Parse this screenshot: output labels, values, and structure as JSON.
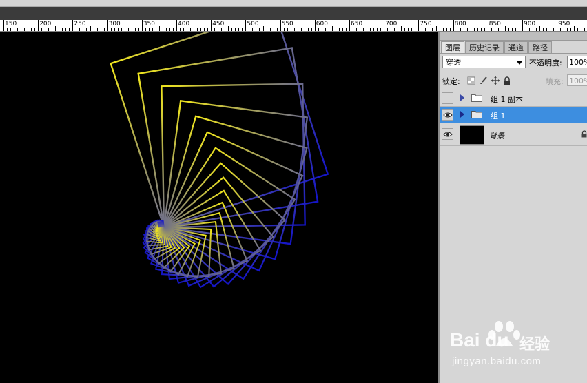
{
  "ruler": {
    "labels": [
      "150",
      "200",
      "250",
      "300",
      "350",
      "400",
      "450",
      "500",
      "550",
      "600",
      "650",
      "700",
      "750",
      "800",
      "850",
      "900",
      "950"
    ]
  },
  "panel": {
    "tabs": [
      "图层",
      "历史记录",
      "通道",
      "路径"
    ],
    "active_tab": "图层",
    "blend_mode": "穿透",
    "opacity_label": "不透明度:",
    "opacity_value": "100%",
    "lock_label": "锁定:",
    "lock_icons": [
      "lock-transparent-icon",
      "lock-brush-icon",
      "lock-move-icon",
      "lock-all-icon"
    ],
    "fill_label": "填充:",
    "fill_value": "100%",
    "layers": [
      {
        "name": "组 1 副本",
        "type": "group",
        "visible": false,
        "selected": false
      },
      {
        "name": "组 1",
        "type": "group",
        "visible": true,
        "selected": true
      },
      {
        "name": "背景",
        "type": "background",
        "visible": true,
        "selected": false,
        "locked": true
      }
    ]
  },
  "watermark": {
    "brand": "Bai du",
    "cn": "经验",
    "url": "jingyan.baidu.com"
  },
  "colors": {
    "selected_row": "#3d8ee0",
    "spiral_blue": "#1414c8",
    "spiral_yellow": "#f0e61e"
  }
}
